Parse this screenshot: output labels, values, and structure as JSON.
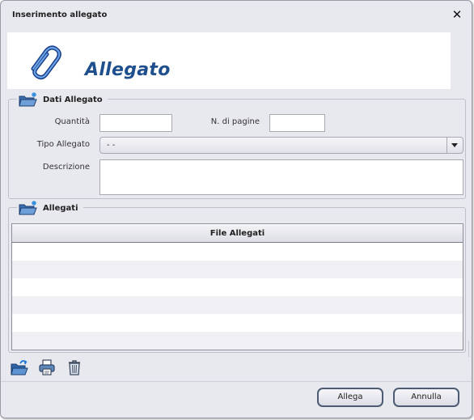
{
  "dialog": {
    "title": "Inserimento allegato",
    "close_label": "✕"
  },
  "banner": {
    "icon": "paperclip-icon",
    "title": "Allegato"
  },
  "dati_allegato": {
    "legend": "Dati Allegato",
    "icon": "folder-new-icon",
    "quantita_label": "Quantità",
    "quantita_value": "",
    "pagine_label": "N. di pagine",
    "pagine_value": "",
    "tipo_label": "Tipo Allegato",
    "tipo_value": "- -",
    "descrizione_label": "Descrizione",
    "descrizione_value": ""
  },
  "allegati": {
    "legend": "Allegati",
    "icon": "folder-new-icon",
    "columns": [
      "File Allegati"
    ],
    "rows": []
  },
  "toolbar": {
    "icons": [
      "open-folder-icon",
      "print-icon",
      "trash-icon"
    ]
  },
  "footer": {
    "allega_label": "Allega",
    "annulla_label": "Annulla"
  },
  "colors": {
    "accent": "#1f4f8c",
    "dialog_bg": "#e8e8ef",
    "button_border": "#4d5c73"
  }
}
